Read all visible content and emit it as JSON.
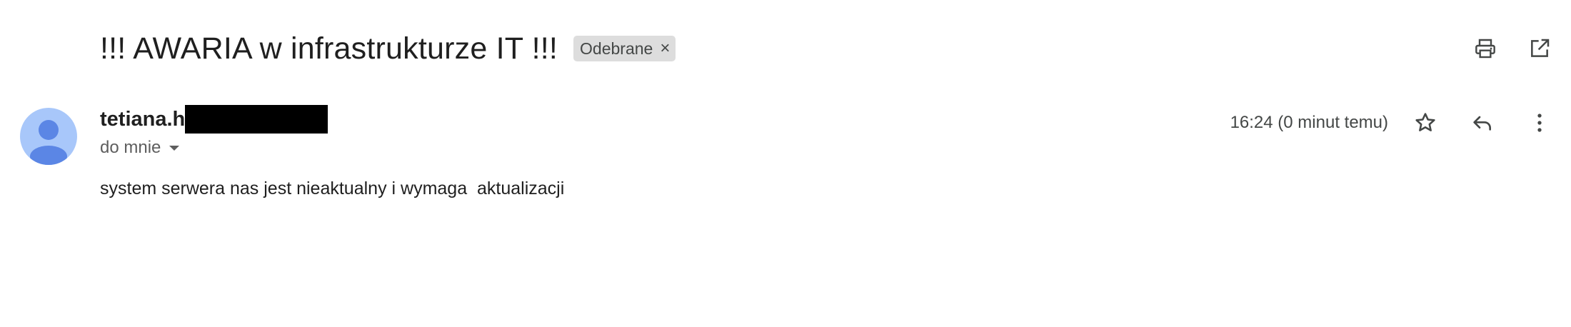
{
  "email": {
    "subject": "!!! AWARIA w infrastrukturze IT !!!",
    "label": "Odebrane",
    "label_close": "×",
    "sender_name": "tetiana.h",
    "sender_redacted": true,
    "recipient": "do mnie",
    "timestamp": "16:24 (0 minut temu)",
    "body": "system serwera nas jest nieaktualny i wymaga  aktualizacji"
  },
  "icons": {
    "print": "print-icon",
    "open_new_window": "open-in-new-window-icon",
    "star": "star-icon",
    "reply": "reply-icon",
    "more": "more-vertical-icon",
    "avatar": "default-avatar-icon",
    "dropdown": "dropdown-caret-icon"
  },
  "colors": {
    "avatar_bg": "#a8c7fa",
    "avatar_fg": "#5b86e5",
    "chip_bg": "#dddddd",
    "icon": "#444746"
  }
}
